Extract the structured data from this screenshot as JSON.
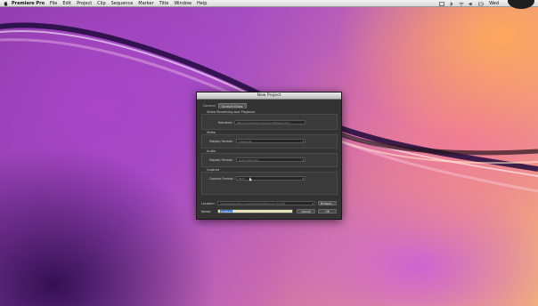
{
  "menubar": {
    "app_name": "Premiere Pro",
    "items": [
      "File",
      "Edit",
      "Project",
      "Clip",
      "Sequence",
      "Marker",
      "Title",
      "Window",
      "Help"
    ],
    "clock": "Wed"
  },
  "dialog": {
    "title": "New Project",
    "tabs": [
      "General",
      "Scratch Disks"
    ],
    "video_rendering": {
      "title": "Video Rendering and Playback",
      "renderer_label": "Renderer:",
      "renderer_value": "Mercury Playback Engine Software Only"
    },
    "video": {
      "title": "Video",
      "display_format_label": "Display Format:",
      "display_format_value": "Timecode"
    },
    "audio": {
      "title": "Audio",
      "display_format_label": "Display Format:",
      "display_format_value": "Audio Samples"
    },
    "capture": {
      "title": "Capture",
      "capture_format_label": "Capture Format:",
      "capture_format_value": "HDV"
    },
    "location_label": "Location:",
    "location_value": "/Users/Apple/Documents/Adobe/Premiere Pro/5.5",
    "browse_label": "Browse...",
    "name_label": "Name:",
    "name_value": "Untitled",
    "cancel_label": "Cancel",
    "ok_label": "OK"
  }
}
